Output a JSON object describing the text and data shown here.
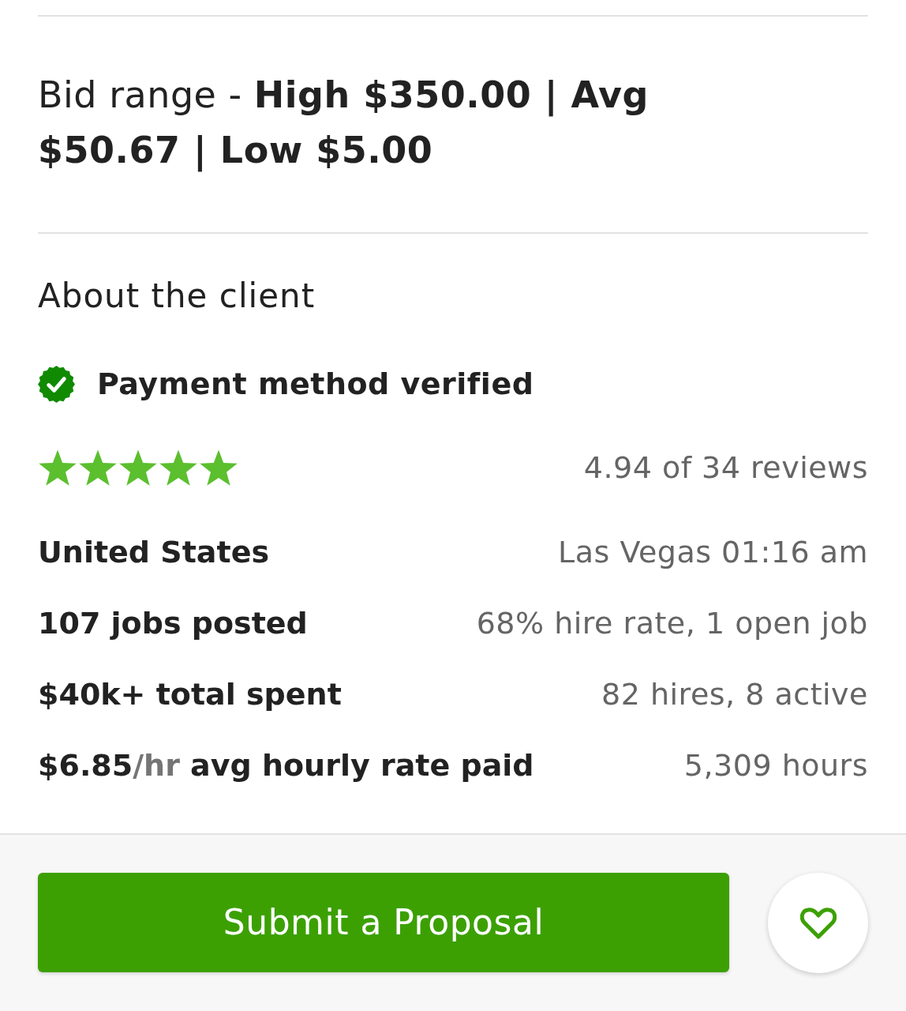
{
  "bid_range": "Bid range - **High $350.00 | Avg $50.67 | Low $5.00**",
  "client": {
    "heading": "About the client",
    "payment": "Payment method verified",
    "rating": {
      "stars": 5,
      "reviews": "4.94 of 34 reviews"
    },
    "facts": [
      {
        "label": "United States",
        "value": "Las Vegas 01:16 am"
      },
      {
        "label": "107 jobs posted",
        "value": "68% hire rate, 1 open job"
      },
      {
        "label": "$40k+ total spent",
        "value": "82 hires, 8 active"
      },
      {
        "label": "$6.85",
        "unit": "/hr",
        "suffix": "avg hourly rate paid",
        "value": "5,309 hours"
      }
    ]
  },
  "footer": {
    "primary_button": "Submit a Proposal"
  }
}
